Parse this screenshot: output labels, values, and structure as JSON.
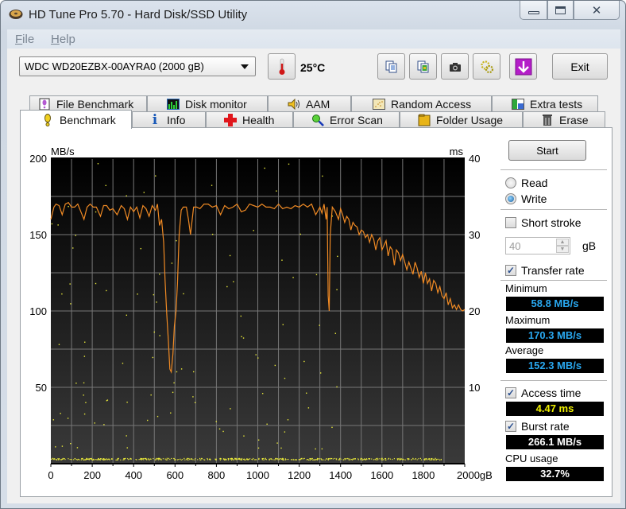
{
  "window": {
    "title": "HD Tune Pro 5.70 - Hard Disk/SSD Utility",
    "controls": {
      "minimize": "—",
      "maximize": "☐",
      "close": "✕"
    }
  },
  "menu": [
    {
      "key": "F",
      "rest": "ile"
    },
    {
      "key": "H",
      "rest": "elp"
    }
  ],
  "toolbar": {
    "drive": "WDC WD20EZBX-00AYRA0 (2000 gB)",
    "temperature": "25°C",
    "exit_label": "Exit",
    "icons": [
      "copy-text-icon",
      "copy-image-icon",
      "screenshot-camera-icon",
      "options-icon",
      "save-down-icon"
    ]
  },
  "tabs": {
    "top": [
      {
        "label": "File Benchmark",
        "icon": "file-benchmark-icon"
      },
      {
        "label": "Disk monitor",
        "icon": "disk-monitor-icon"
      },
      {
        "label": "AAM",
        "icon": "speaker-icon"
      },
      {
        "label": "Random Access",
        "icon": "random-access-icon"
      },
      {
        "label": "Extra tests",
        "icon": "extra-tests-icon"
      }
    ],
    "bottom": [
      {
        "label": "Benchmark",
        "icon": "benchmark-icon",
        "active": true
      },
      {
        "label": "Info",
        "icon": "info-icon"
      },
      {
        "label": "Health",
        "icon": "health-cross-icon"
      },
      {
        "label": "Error Scan",
        "icon": "magnifier-icon"
      },
      {
        "label": "Folder Usage",
        "icon": "folder-icon"
      },
      {
        "label": "Erase",
        "icon": "trash-icon"
      }
    ]
  },
  "controls": {
    "start_label": "Start",
    "read_label": "Read",
    "write_label": "Write",
    "mode_selected": "Write",
    "short_stroke_label": "Short stroke",
    "short_stroke_checked": false,
    "short_stroke_value": "40",
    "short_stroke_unit": "gB",
    "transfer_rate_label": "Transfer rate",
    "transfer_rate_checked": true,
    "minimum_label": "Minimum",
    "minimum_value": "58.8 MB/s",
    "maximum_label": "Maximum",
    "maximum_value": "170.3 MB/s",
    "average_label": "Average",
    "average_value": "152.3 MB/s",
    "access_time_label": "Access time",
    "access_time_checked": true,
    "access_time_value": "4.47 ms",
    "burst_rate_label": "Burst rate",
    "burst_rate_checked": true,
    "burst_rate_value": "266.1 MB/s",
    "cpu_usage_label": "CPU usage",
    "cpu_usage_value": "32.7%"
  },
  "colors": {
    "transfer_line": "#f08a24",
    "access_points": "#e8e83a",
    "value_blue": "#29a8f0",
    "value_yellow": "#f0f000",
    "value_white": "#ffffff"
  },
  "chart_data": {
    "type": "line",
    "title": "",
    "xlabel": "gB",
    "ylabel": "MB/s",
    "y2label": "ms",
    "xlim": [
      0,
      2000
    ],
    "ylim": [
      0,
      200
    ],
    "y2lim": [
      0,
      40
    ],
    "grid": true,
    "x_ticks": [
      "0",
      "200",
      "400",
      "600",
      "800",
      "1000",
      "1200",
      "1400",
      "1600",
      "1800",
      "2000gB"
    ],
    "y_ticks": [
      "50",
      "100",
      "150",
      "200"
    ],
    "y2_ticks": [
      "10",
      "20",
      "30",
      "40"
    ],
    "series": [
      {
        "name": "Transfer rate",
        "unit": "MB/s",
        "x": [
          0,
          15,
          25,
          40,
          55,
          70,
          85,
          100,
          115,
          130,
          145,
          160,
          175,
          190,
          205,
          220,
          240,
          255,
          270,
          285,
          300,
          320,
          340,
          355,
          370,
          385,
          400,
          415,
          430,
          445,
          460,
          475,
          490,
          505,
          515,
          525,
          535,
          545,
          552,
          560,
          568,
          575,
          582,
          590,
          597,
          605,
          612,
          620,
          630,
          640,
          648,
          655,
          665,
          675,
          690,
          705,
          720,
          740,
          760,
          780,
          800,
          820,
          840,
          860,
          880,
          900,
          920,
          940,
          960,
          980,
          1000,
          1020,
          1040,
          1060,
          1080,
          1100,
          1120,
          1140,
          1160,
          1180,
          1200,
          1220,
          1240,
          1260,
          1280,
          1300,
          1310,
          1320,
          1330,
          1335,
          1340,
          1345,
          1350,
          1360,
          1375,
          1390,
          1400,
          1410,
          1420,
          1430,
          1440,
          1450,
          1460,
          1470,
          1480,
          1490,
          1500,
          1510,
          1520,
          1530,
          1540,
          1550,
          1560,
          1570,
          1580,
          1590,
          1600,
          1610,
          1620,
          1630,
          1640,
          1650,
          1660,
          1670,
          1680,
          1690,
          1700,
          1710,
          1720,
          1730,
          1740,
          1750,
          1760,
          1770,
          1780,
          1790,
          1800,
          1810,
          1820,
          1830,
          1840,
          1850,
          1860,
          1870,
          1880,
          1890,
          1900,
          1910,
          1920,
          1930,
          1940,
          1950,
          1960,
          1970,
          1980,
          1990,
          2000
        ],
        "values": [
          160,
          168,
          170,
          169,
          163,
          170,
          171,
          168,
          168,
          170,
          165,
          160,
          168,
          170,
          168,
          168,
          162,
          169,
          169,
          166,
          167,
          163,
          169,
          167,
          160,
          168,
          165,
          168,
          161,
          169,
          167,
          162,
          169,
          166,
          170,
          156,
          160,
          145,
          120,
          98,
          80,
          62,
          60,
          72,
          90,
          100,
          118,
          150,
          166,
          168,
          168,
          168,
          160,
          150,
          168,
          168,
          167,
          170,
          170,
          168,
          169,
          163,
          169,
          167,
          168,
          170,
          165,
          166,
          170,
          169,
          168,
          170,
          168,
          168,
          167,
          170,
          167,
          168,
          167,
          169,
          168,
          170,
          168,
          170,
          163,
          168,
          164,
          170,
          160,
          168,
          110,
          100,
          150,
          168,
          165,
          160,
          167,
          163,
          158,
          162,
          160,
          153,
          158,
          156,
          155,
          150,
          153,
          152,
          148,
          150,
          145,
          150,
          147,
          140,
          146,
          148,
          140,
          143,
          146,
          136,
          142,
          140,
          130,
          140,
          138,
          133,
          137,
          132,
          127,
          132,
          128,
          124,
          132,
          128,
          122,
          126,
          118,
          125,
          118,
          121,
          113,
          120,
          118,
          112,
          116,
          110,
          108,
          112,
          104,
          108,
          102,
          104,
          101,
          104,
          101,
          100,
          101,
          100,
          101,
          101,
          100
        ]
      },
      {
        "name": "Access time",
        "unit": "ms",
        "points_description": "scattered yellow points, dense band near 0.5–1 ms across 0–1900 gB, sparse points 2–40 ms"
      }
    ]
  }
}
